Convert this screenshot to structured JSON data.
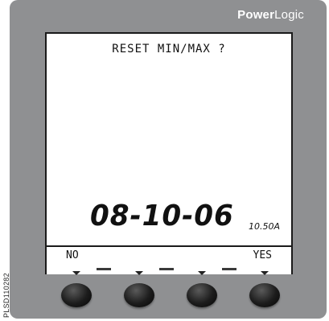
{
  "brand": {
    "bold": "Power",
    "light": "Logic"
  },
  "screen": {
    "prompt": "RESET MIN/MAX ?",
    "date": "08-10-06",
    "version": "10.50A"
  },
  "softkeys": {
    "left_label": "NO",
    "right_label": "YES"
  },
  "buttons": [
    {
      "name": "softkey-1-button"
    },
    {
      "name": "softkey-2-button"
    },
    {
      "name": "softkey-3-button"
    },
    {
      "name": "softkey-4-button"
    }
  ],
  "side_code": "PLSD110282"
}
